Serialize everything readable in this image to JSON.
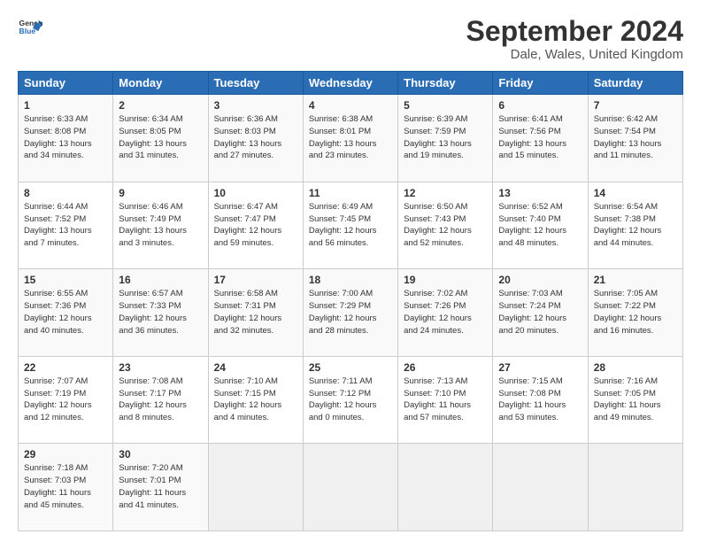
{
  "logo": {
    "line1": "General",
    "line2": "Blue"
  },
  "title": "September 2024",
  "subtitle": "Dale, Wales, United Kingdom",
  "header_days": [
    "Sunday",
    "Monday",
    "Tuesday",
    "Wednesday",
    "Thursday",
    "Friday",
    "Saturday"
  ],
  "weeks": [
    [
      {
        "day": "1",
        "info": "Sunrise: 6:33 AM\nSunset: 8:08 PM\nDaylight: 13 hours\nand 34 minutes."
      },
      {
        "day": "2",
        "info": "Sunrise: 6:34 AM\nSunset: 8:05 PM\nDaylight: 13 hours\nand 31 minutes."
      },
      {
        "day": "3",
        "info": "Sunrise: 6:36 AM\nSunset: 8:03 PM\nDaylight: 13 hours\nand 27 minutes."
      },
      {
        "day": "4",
        "info": "Sunrise: 6:38 AM\nSunset: 8:01 PM\nDaylight: 13 hours\nand 23 minutes."
      },
      {
        "day": "5",
        "info": "Sunrise: 6:39 AM\nSunset: 7:59 PM\nDaylight: 13 hours\nand 19 minutes."
      },
      {
        "day": "6",
        "info": "Sunrise: 6:41 AM\nSunset: 7:56 PM\nDaylight: 13 hours\nand 15 minutes."
      },
      {
        "day": "7",
        "info": "Sunrise: 6:42 AM\nSunset: 7:54 PM\nDaylight: 13 hours\nand 11 minutes."
      }
    ],
    [
      {
        "day": "8",
        "info": "Sunrise: 6:44 AM\nSunset: 7:52 PM\nDaylight: 13 hours\nand 7 minutes."
      },
      {
        "day": "9",
        "info": "Sunrise: 6:46 AM\nSunset: 7:49 PM\nDaylight: 13 hours\nand 3 minutes."
      },
      {
        "day": "10",
        "info": "Sunrise: 6:47 AM\nSunset: 7:47 PM\nDaylight: 12 hours\nand 59 minutes."
      },
      {
        "day": "11",
        "info": "Sunrise: 6:49 AM\nSunset: 7:45 PM\nDaylight: 12 hours\nand 56 minutes."
      },
      {
        "day": "12",
        "info": "Sunrise: 6:50 AM\nSunset: 7:43 PM\nDaylight: 12 hours\nand 52 minutes."
      },
      {
        "day": "13",
        "info": "Sunrise: 6:52 AM\nSunset: 7:40 PM\nDaylight: 12 hours\nand 48 minutes."
      },
      {
        "day": "14",
        "info": "Sunrise: 6:54 AM\nSunset: 7:38 PM\nDaylight: 12 hours\nand 44 minutes."
      }
    ],
    [
      {
        "day": "15",
        "info": "Sunrise: 6:55 AM\nSunset: 7:36 PM\nDaylight: 12 hours\nand 40 minutes."
      },
      {
        "day": "16",
        "info": "Sunrise: 6:57 AM\nSunset: 7:33 PM\nDaylight: 12 hours\nand 36 minutes."
      },
      {
        "day": "17",
        "info": "Sunrise: 6:58 AM\nSunset: 7:31 PM\nDaylight: 12 hours\nand 32 minutes."
      },
      {
        "day": "18",
        "info": "Sunrise: 7:00 AM\nSunset: 7:29 PM\nDaylight: 12 hours\nand 28 minutes."
      },
      {
        "day": "19",
        "info": "Sunrise: 7:02 AM\nSunset: 7:26 PM\nDaylight: 12 hours\nand 24 minutes."
      },
      {
        "day": "20",
        "info": "Sunrise: 7:03 AM\nSunset: 7:24 PM\nDaylight: 12 hours\nand 20 minutes."
      },
      {
        "day": "21",
        "info": "Sunrise: 7:05 AM\nSunset: 7:22 PM\nDaylight: 12 hours\nand 16 minutes."
      }
    ],
    [
      {
        "day": "22",
        "info": "Sunrise: 7:07 AM\nSunset: 7:19 PM\nDaylight: 12 hours\nand 12 minutes."
      },
      {
        "day": "23",
        "info": "Sunrise: 7:08 AM\nSunset: 7:17 PM\nDaylight: 12 hours\nand 8 minutes."
      },
      {
        "day": "24",
        "info": "Sunrise: 7:10 AM\nSunset: 7:15 PM\nDaylight: 12 hours\nand 4 minutes."
      },
      {
        "day": "25",
        "info": "Sunrise: 7:11 AM\nSunset: 7:12 PM\nDaylight: 12 hours\nand 0 minutes."
      },
      {
        "day": "26",
        "info": "Sunrise: 7:13 AM\nSunset: 7:10 PM\nDaylight: 11 hours\nand 57 minutes."
      },
      {
        "day": "27",
        "info": "Sunrise: 7:15 AM\nSunset: 7:08 PM\nDaylight: 11 hours\nand 53 minutes."
      },
      {
        "day": "28",
        "info": "Sunrise: 7:16 AM\nSunset: 7:05 PM\nDaylight: 11 hours\nand 49 minutes."
      }
    ],
    [
      {
        "day": "29",
        "info": "Sunrise: 7:18 AM\nSunset: 7:03 PM\nDaylight: 11 hours\nand 45 minutes."
      },
      {
        "day": "30",
        "info": "Sunrise: 7:20 AM\nSunset: 7:01 PM\nDaylight: 11 hours\nand 41 minutes."
      },
      {
        "day": "",
        "info": ""
      },
      {
        "day": "",
        "info": ""
      },
      {
        "day": "",
        "info": ""
      },
      {
        "day": "",
        "info": ""
      },
      {
        "day": "",
        "info": ""
      }
    ]
  ]
}
